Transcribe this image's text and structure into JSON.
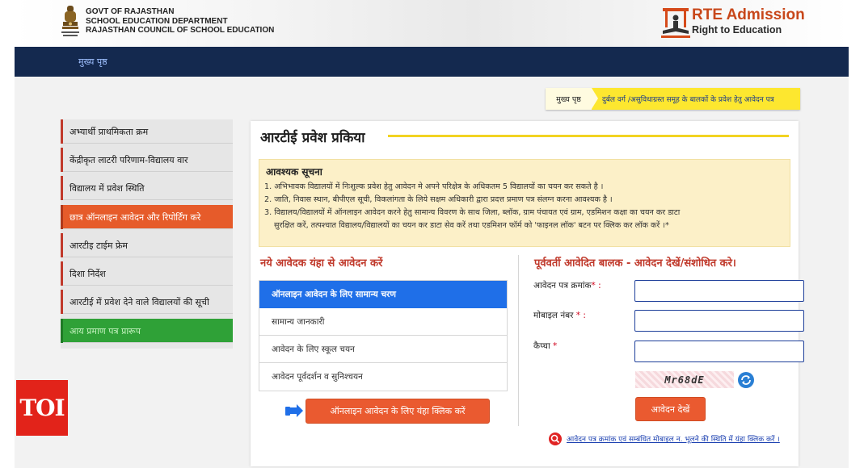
{
  "header": {
    "govt_lines": [
      "GOVT OF RAJASTHAN",
      "SCHOOL EDUCATION DEPARTMENT",
      "RAJASTHAN COUNCIL OF SCHOOL EDUCATION"
    ],
    "rte_title": "RTE Admission",
    "rte_subtitle": "Right to Education"
  },
  "nav": {
    "home": "मुख्य पृष्ठ"
  },
  "breadcrumb": {
    "home": "मुख्य पृष्ठ",
    "current": "दुर्बल वर्ग /असुविधाग्रस्त समूह के बालकों के प्रवेश हेतु आवेदन पत्र"
  },
  "sidebar": {
    "items": [
      {
        "label": "अभ्यार्थी प्राथमिकता क्रम"
      },
      {
        "label": "केंद्रीकृत लाटरी परिणाम-विद्यालय वार"
      },
      {
        "label": "विद्यालय में प्रवेश स्थिति"
      },
      {
        "label": "छात्र ऑनलाइन आवेदन और रिपोर्टिंग करे"
      },
      {
        "label": "आरटीइ टाईम फ्रेम"
      },
      {
        "label": "दिशा निर्देश"
      },
      {
        "label": "आरटीई में प्रवेश देने वाले विद्यालयों की सूची"
      },
      {
        "label": "आय प्रमाण पत्र प्रारूप"
      }
    ]
  },
  "main": {
    "title": "आरटीई प्रवेश प्रकिया",
    "notice": {
      "title": "आवश्यक सूचना",
      "lines": [
        "1. अभिभावक विद्यालयों में निःशुल्क प्रवेश हेतु आवेदन मे अपने परिक्षेत्र के अधिकतम 5 विद्यालयों का चयन कर सकते है ।",
        "2. जाति, निवास स्थान, बीपीएल सूची, विकलांगता के लिये सक्षम अधिकारी द्वारा प्रदत्त प्रमाण पत्र संलग्न करना आवश्यक है ।",
        "3. विद्यालय/विद्यालयों में ऑनलाइन आवेदन करने हेतु सामान्य विवरण के साथ जिला, ब्लॉक, ग्राम पंचायत एवं ग्राम, एडमिशन कक्षा का चयन कर डाटा",
        "सुरक्षित करें, तत्पश्चात विद्यालय/विद्यालयों का चयन कर डाटा सेव करें तथा एडमिशन फॉर्म को 'फाइनल लॉक' बटन पर क्लिक कर लॉक करें ।*"
      ]
    },
    "new_applicant": {
      "heading": "नये आवेदक यंहा से आवेदन करें",
      "steps": [
        "ऑनलाइन आवेदन के लिए सामान्य चरण",
        "सामान्य जानकारी",
        "आवेदन के लिए स्कूल चयन",
        "आवेदन पूर्वदर्शन व सुनिश्चयन"
      ],
      "apply_button": "ऑनलाइन आवेदन के लिए यंहा क्लिक करें"
    },
    "previous": {
      "heading": "पूर्ववर्ती आवेदित बालक - आवेदन देखें/संशोधित करे।",
      "fields": [
        {
          "label": "आवेदन पत्र क्रमांक",
          "required_mark": "* :",
          "value": ""
        },
        {
          "label": "मोबाइल नंबर",
          "required_mark": " * :",
          "value": ""
        },
        {
          "label": "कैप्चा",
          "required_mark": " *",
          "value": ""
        }
      ],
      "captcha_text": "Mr68dE",
      "view_button": "आवेदन देखें",
      "forgot_link": "आवेदन पत्र क्रमांक एवं सम्बंधित मोबाइल न. भूलने की स्थिति में यंहा क्लिक करें ।"
    }
  },
  "watermark": {
    "text": "TOI"
  },
  "colors": {
    "navbar": "#14294f",
    "accent_orange": "#ea5a30",
    "heading_red": "#c0392b",
    "step_blue": "#1f6fe8",
    "sidebar_green": "#2fa137"
  },
  "icons": [
    "emblem-icon",
    "rte-logo-icon",
    "hand-pointer-icon",
    "refresh-icon",
    "search-icon"
  ]
}
